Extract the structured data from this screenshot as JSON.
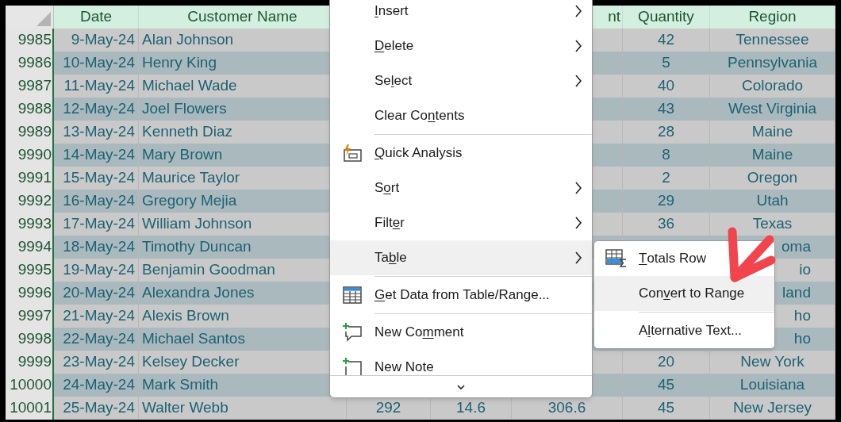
{
  "header": {
    "date": "Date",
    "customer_name": "Customer Name",
    "column_5": "nt",
    "quantity": "Quantity",
    "region": "Region"
  },
  "rows": [
    {
      "row": "9985",
      "date": "9-May-24",
      "customer_name": "Alan Johnson",
      "quantity": "42",
      "region": "Tennessee",
      "region_cut": false
    },
    {
      "row": "9986",
      "date": "10-May-24",
      "customer_name": "Henry King",
      "quantity": "5",
      "region": "Pennsylvania",
      "region_cut": false
    },
    {
      "row": "9987",
      "date": "11-May-24",
      "customer_name": "Michael Wade",
      "quantity": "40",
      "region": "Colorado",
      "region_cut": false
    },
    {
      "row": "9988",
      "date": "12-May-24",
      "customer_name": "Joel Flowers",
      "quantity": "43",
      "region": "West Virginia",
      "region_cut": false
    },
    {
      "row": "9989",
      "date": "13-May-24",
      "customer_name": "Kenneth Diaz",
      "quantity": "28",
      "region": "Maine",
      "region_cut": false
    },
    {
      "row": "9990",
      "date": "14-May-24",
      "customer_name": "Mary Brown",
      "quantity": "8",
      "region": "Maine",
      "region_cut": false
    },
    {
      "row": "9991",
      "date": "15-May-24",
      "customer_name": "Maurice Taylor",
      "quantity": "2",
      "region": "Oregon",
      "region_cut": false
    },
    {
      "row": "9992",
      "date": "16-May-24",
      "customer_name": "Gregory Mejia",
      "quantity": "29",
      "region": "Utah",
      "region_cut": false
    },
    {
      "row": "9993",
      "date": "17-May-24",
      "customer_name": "William Johnson",
      "quantity": "36",
      "region": "Texas",
      "region_cut": false
    },
    {
      "row": "9994",
      "date": "18-May-24",
      "customer_name": "Timothy Duncan",
      "region": "oma",
      "region_cut": true
    },
    {
      "row": "9995",
      "date": "19-May-24",
      "customer_name": "Benjamin Goodman",
      "region": "io",
      "region_cut": true
    },
    {
      "row": "9996",
      "date": "20-May-24",
      "customer_name": "Alexandra Jones",
      "region": "land",
      "region_cut": true
    },
    {
      "row": "9997",
      "date": "21-May-24",
      "customer_name": "Alexis Brown",
      "region": "ho",
      "region_cut": true
    },
    {
      "row": "9998",
      "date": "22-May-24",
      "customer_name": "Michael Santos",
      "region": "ho",
      "region_cut": true
    },
    {
      "row": "9999",
      "date": "23-May-24",
      "customer_name": "Kelsey Decker",
      "quantity": "20",
      "region": "New York",
      "region_cut": false
    },
    {
      "row": "10000",
      "date": "24-May-24",
      "customer_name": "Mark Smith",
      "quantity": "45",
      "region": "Louisiana",
      "region_cut": false
    },
    {
      "row": "10001",
      "date": "25-May-24",
      "customer_name": "Walter Webb",
      "column_3": "292",
      "column_4": "14.6",
      "column_5": "306.6",
      "quantity": "45",
      "region": "New Jersey",
      "region_cut": false
    }
  ],
  "context_menu": {
    "items": [
      {
        "kind": "submenu",
        "key": "I",
        "post": "nsert",
        "selected": false,
        "divider_after": false
      },
      {
        "kind": "submenu",
        "key": "D",
        "post": "elete",
        "selected": false,
        "divider_after": false
      },
      {
        "kind": "submenu",
        "pre": "Se",
        "key": "l",
        "post": "ect",
        "selected": false,
        "divider_after": false
      },
      {
        "kind": "command",
        "pre": "Clear Co",
        "key": "n",
        "post": "tents",
        "selected": false,
        "divider_after": true
      },
      {
        "kind": "analysis",
        "key": "Q",
        "post": "uick Analysis",
        "selected": false,
        "divider_after": false
      },
      {
        "kind": "submenu",
        "pre": "S",
        "key": "o",
        "post": "rt",
        "selected": false,
        "divider_after": false
      },
      {
        "kind": "submenu",
        "pre": "Filt",
        "key": "e",
        "post": "r",
        "selected": false,
        "divider_after": false
      },
      {
        "kind": "submenu",
        "pre": "Ta",
        "key": "b",
        "post": "le",
        "selected": true,
        "divider_after": true
      },
      {
        "kind": "table-data",
        "key": "G",
        "post": "et Data from Table/Range...",
        "selected": false,
        "divider_after": true
      },
      {
        "kind": "comment",
        "pre": "New Co",
        "key": "m",
        "post": "ment",
        "selected": false,
        "divider_after": false
      },
      {
        "kind": "note",
        "pre": "New Note",
        "selected": false,
        "divider_after": false
      }
    ],
    "submenu": [
      {
        "kind": "totals",
        "key": "T",
        "post": "otals Row",
        "selected": false,
        "divider_after": false
      },
      {
        "kind": "command",
        "pre": "Con",
        "key": "v",
        "post": "ert to Range",
        "selected": true,
        "divider_after": true
      },
      {
        "kind": "command",
        "pre": "A",
        "key": "l",
        "post": "ternative Text...",
        "selected": false,
        "divider_after": false
      }
    ]
  }
}
